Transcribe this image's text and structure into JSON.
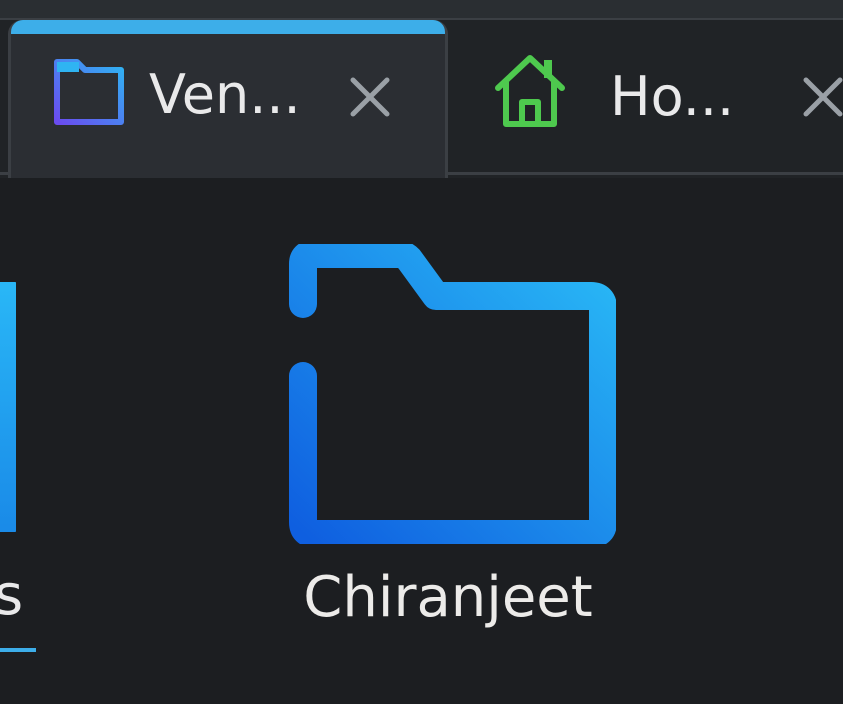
{
  "tabs": [
    {
      "label": "Ven...",
      "icon": "folder-icon",
      "active": true,
      "accent_color": "#3daee9",
      "close_glyph": "×"
    },
    {
      "label": "Ho...",
      "icon": "home-icon",
      "active": false,
      "close_glyph": "×"
    }
  ],
  "items": [
    {
      "label": "s",
      "icon": "folder-icon",
      "selected": true
    },
    {
      "label": "Chiranjeet",
      "icon": "folder-icon",
      "selected": false
    }
  ],
  "colors": {
    "background": "#1c1e21",
    "tab_active_bg": "#2b2e33",
    "accent": "#3daee9",
    "text": "#e9e9ea",
    "folder_blue_dark": "#1565e0",
    "folder_blue_light": "#29b6f6",
    "home_green": "#4ec94e"
  }
}
